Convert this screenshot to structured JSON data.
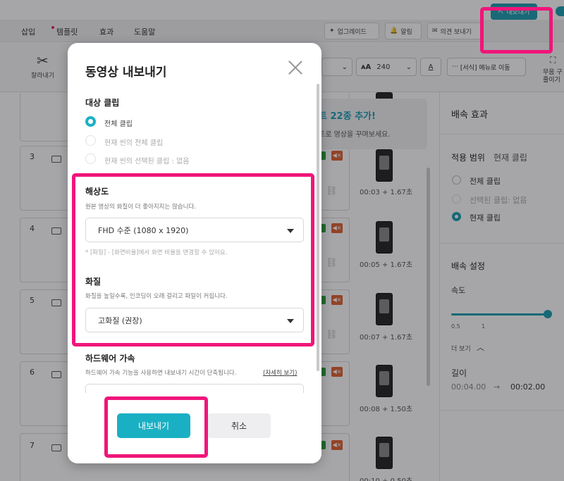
{
  "menubar": {
    "items": [
      "삽입",
      "템플릿",
      "효과",
      "도움말"
    ],
    "upgrade": "업그레이드",
    "notifications": "알림",
    "feedback": "의견 보내기",
    "export": "내보내기"
  },
  "toolbar": {
    "cut_label": "잘라내기",
    "font_size": "240",
    "font_a": "A",
    "style_menu": "[서식] 메뉴로 이동",
    "right_label_1": "무음 구",
    "right_label_2": "줄이기"
  },
  "timeline": {
    "tracks": [
      {
        "num": "3",
        "time": "00:03 + 1.67초"
      },
      {
        "num": "4",
        "time": "00:05 + 1.67초"
      },
      {
        "num": "5",
        "time": "00:07 + 1.67초"
      },
      {
        "num": "6",
        "time": "00:08 + 1.50초"
      },
      {
        "num": "7",
        "time": "00:10 + 0.50초"
      }
    ]
  },
  "tooltip": {
    "line1": "트 22종 추가!",
    "line2": "트로 영상을 꾸며보세요."
  },
  "right_panel": {
    "title": "배속 효과",
    "scope_label": "적용 범위",
    "scope_value": "현재 클립",
    "options": [
      "전체 클립",
      "선택된 클립: 없음",
      "현재 클립"
    ],
    "settings_title": "배속 설정",
    "speed_label": "속도",
    "tick_05": "0.5",
    "tick_1": "1",
    "more": "더 보기",
    "length_label": "길이",
    "length_from": "00:04.00",
    "arrow": "→",
    "length_to": "00:02.00"
  },
  "modal": {
    "title": "동영상 내보내기",
    "target_title": "대상 클립",
    "target_options": [
      "전체 클립",
      "현재 씬의 전체 클립",
      "현재 씬의 선택된 클립 : 없음"
    ],
    "resolution_title": "해상도",
    "resolution_hint": "원본 영상의 화질이 더 좋아지지는 않습니다.",
    "resolution_value": "FHD 수준 (1080 x 1920)",
    "resolution_note": "* [파일] - [화면비율]에서 화면 비율을 변경할 수 있어요.",
    "quality_title": "화질",
    "quality_hint": "화질을 높일수록, 인코딩이 오래 걸리고 파일이 커집니다.",
    "quality_value": "고화질 (권장)",
    "hw_title": "하드웨어 가속",
    "hw_hint": "하드웨어 가속 기능을 사용하면 내보내기 시간이 단축됩니다.",
    "hw_link": "(자세히 보기)",
    "export_button": "내보내기",
    "cancel_button": "취소"
  },
  "colors": {
    "accent": "#1ab0c4",
    "highlight": "#f0157a"
  }
}
